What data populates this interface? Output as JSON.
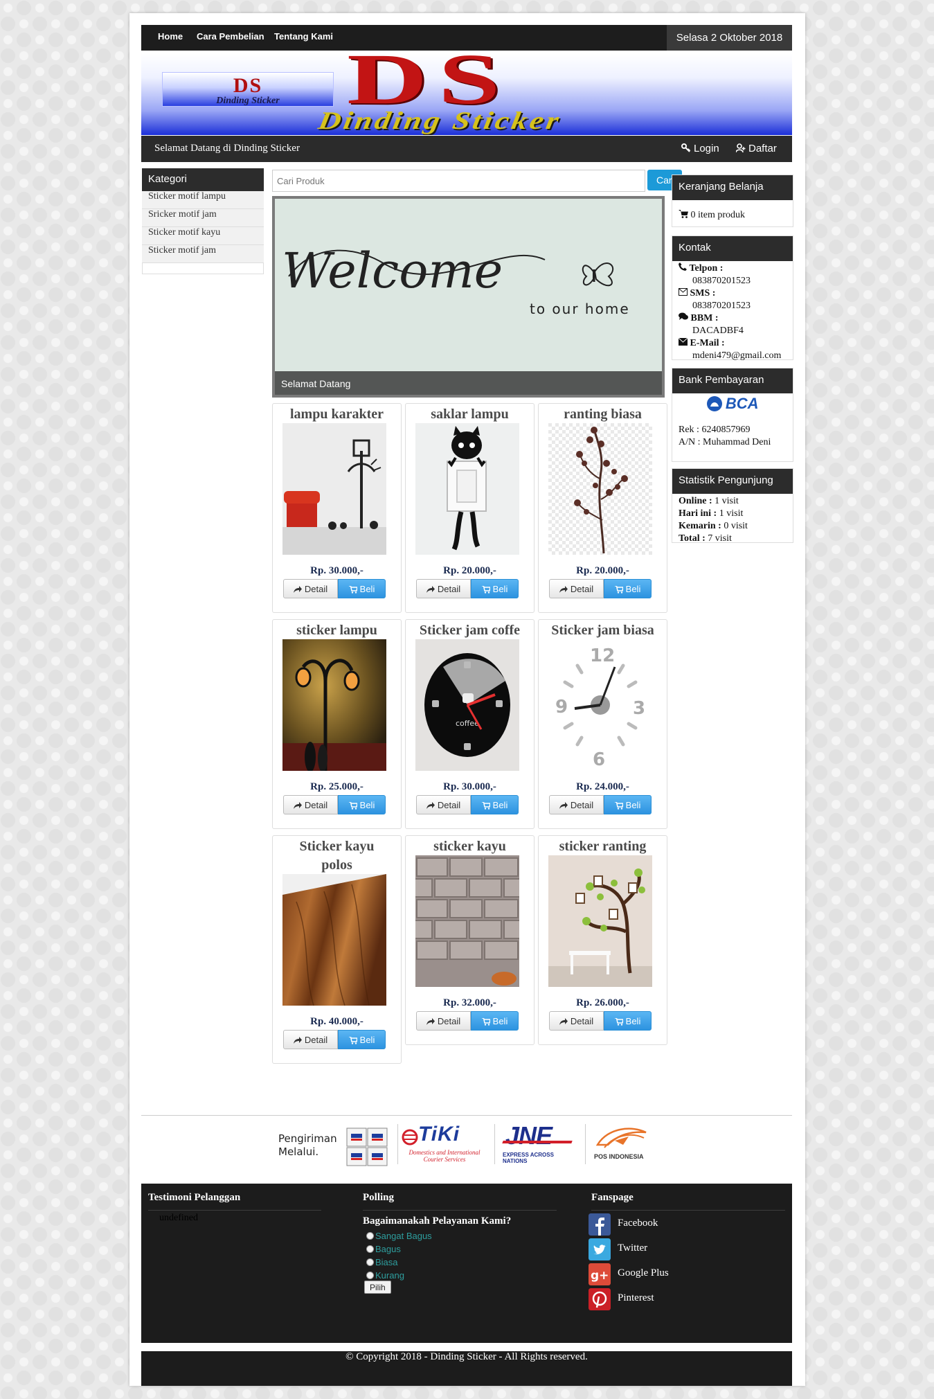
{
  "nav": {
    "items": [
      {
        "label": "Home"
      },
      {
        "label": "Cara Pembelian"
      },
      {
        "label": "Tentang Kami"
      }
    ],
    "date": "Selasa 2 Oktober 2018"
  },
  "banner": {
    "logo_small_ds": "DS",
    "logo_small_sub": "Dinding Sticker",
    "logo_big": "DS",
    "logo_name": "Dinding Sticker"
  },
  "welcome": {
    "message": "Selamat Datang di Dinding Sticker",
    "login": "Login",
    "register": "Daftar"
  },
  "kategori": {
    "title": "Kategori",
    "items": [
      "Sticker motif lampu",
      "Sricker motif jam",
      "Sticker motif kayu",
      "Sticker motif jam"
    ]
  },
  "search": {
    "placeholder": "Cari Produk",
    "button": "Cari"
  },
  "slider": {
    "main_text": "Welcome",
    "sub_text": "to our home",
    "caption": "Selamat Datang"
  },
  "products": [
    {
      "title": "lampu karakter",
      "price": "Rp. 30.000,-"
    },
    {
      "title": "saklar lampu",
      "price": "Rp. 20.000,-"
    },
    {
      "title": "ranting biasa",
      "price": "Rp. 20.000,-"
    },
    {
      "title": "sticker lampu",
      "price": "Rp. 25.000,-"
    },
    {
      "title": "Sticker jam coffe",
      "price": "Rp. 30.000,-"
    },
    {
      "title": "Sticker jam biasa",
      "price": "Rp. 24.000,-"
    },
    {
      "title": "Sticker kayu polos",
      "price": "Rp. 40.000,-"
    },
    {
      "title": "sticker kayu",
      "price": "Rp. 32.000,-"
    },
    {
      "title": "sticker ranting",
      "price": "Rp. 26.000,-"
    }
  ],
  "product_buttons": {
    "detail": "Detail",
    "buy": "Beli"
  },
  "cart": {
    "title": "Keranjang Belanja",
    "text": "0 item produk"
  },
  "contact": {
    "title": "Kontak",
    "phone_label": "Telpon :",
    "phone": "083870201523",
    "sms_label": "SMS :",
    "sms": "083870201523",
    "bbm_label": "BBM :",
    "bbm": "DACADBF4",
    "email_label": "E-Mail :",
    "email": "mdeni479@gmail.com"
  },
  "bank": {
    "title": "Bank Pembayaran",
    "logo": "BCA",
    "rek": "Rek : 6240857969",
    "an": "A/N : Muhammad Deni"
  },
  "stats": {
    "title": "Statistik Pengunjung",
    "online_label": "Online :",
    "online": "1 visit",
    "today_label": "Hari ini :",
    "today": "1 visit",
    "yesterday_label": "Kemarin :",
    "yesterday": "0 visit",
    "total_label": "Total :",
    "total": "7 visit"
  },
  "shipping": {
    "label_line1": "Pengiriman",
    "label_line2": "Melalui.",
    "tiki": "TiKi",
    "tiki_sub": "Domestics and International Courier Services",
    "jne": "JNE",
    "jne_sub": "EXPRESS ACROSS NATIONS",
    "pos": "POS INDONESIA"
  },
  "footer": {
    "testimoni_title": "Testimoni Pelanggan",
    "testimoni_text": "undefined",
    "polling_title": "Polling",
    "polling_question": "Bagaimanakah Pelayanan Kami?",
    "polling_options": [
      "Sangat Bagus",
      "Bagus",
      "Biasa",
      "Kurang"
    ],
    "polling_button": "Pilih",
    "fanspage_title": "Fanspage",
    "fanspage": [
      "Facebook",
      "Twitter",
      "Google Plus",
      "Pinterest"
    ]
  },
  "copyright": "© Copyright 2018 - Dinding Sticker - All Rights reserved."
}
